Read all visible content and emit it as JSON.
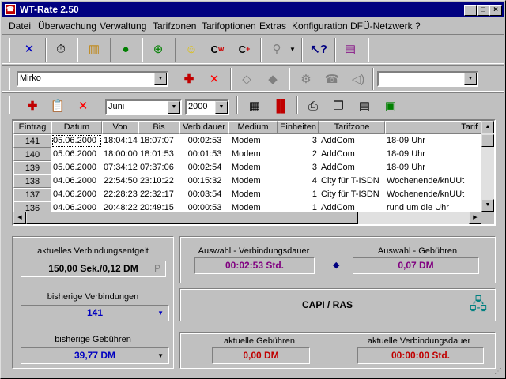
{
  "window": {
    "title": "WT-Rate 2.50"
  },
  "menu": [
    "Datei",
    "Überwachung",
    "Verwaltung",
    "Tarifzonen",
    "Tarifoptionen",
    "Extras",
    "Konfiguration",
    "DFÜ-Netzwerk",
    "?"
  ],
  "toolbar2": {
    "user_value": "Mirko",
    "second_value": ""
  },
  "toolbar3": {
    "month_value": "Juni",
    "year_value": "2000"
  },
  "table": {
    "headers": [
      "Eintrag",
      "Datum",
      "Von",
      "Bis",
      "Verb.dauer",
      "Medium",
      "Einheiten",
      "Tarifzone",
      "Tarif"
    ],
    "rows": [
      [
        "141",
        "05.06.2000",
        "18:04:14",
        "18:07:07",
        "00:02:53",
        "Modem",
        "3",
        "AddCom",
        "18-09 Uhr"
      ],
      [
        "140",
        "05.06.2000",
        "18:00:00",
        "18:01:53",
        "00:01:53",
        "Modem",
        "2",
        "AddCom",
        "18-09 Uhr"
      ],
      [
        "139",
        "05.06.2000",
        "07:34:12",
        "07:37:06",
        "00:02:54",
        "Modem",
        "3",
        "AddCom",
        "18-09 Uhr"
      ],
      [
        "138",
        "04.06.2000",
        "22:54:50",
        "23:10:22",
        "00:15:32",
        "Modem",
        "4",
        "City für T-ISDN",
        "Wochenende/knUUt"
      ],
      [
        "137",
        "04.06.2000",
        "22:28:23",
        "22:32:17",
        "00:03:54",
        "Modem",
        "1",
        "City für T-ISDN",
        "Wochenende/knUUt"
      ],
      [
        "136",
        "04.06.2000",
        "20:48:22",
        "20:49:15",
        "00:00:53",
        "Modem",
        "1",
        "AddCom",
        "rund um die Uhr"
      ]
    ]
  },
  "left": {
    "fee_label": "aktuelles Verbindungsentgelt",
    "fee_value": "150,00 Sek./0,12 DM",
    "fee_badge": "P",
    "conn_label": "bisherige Verbindungen",
    "conn_value": "141",
    "fees_label": "bisherige Gebühren",
    "fees_value": "39,77 DM"
  },
  "right": {
    "sel_duration_label": "Auswahl - Verbindungsdauer",
    "sel_duration_value": "00:02:53 Std.",
    "sel_fees_label": "Auswahl - Gebühren",
    "sel_fees_value": "0,07 DM",
    "capi_label": "CAPI / RAS",
    "cur_fees_label": "aktuelle Gebühren",
    "cur_fees_value": "0,00 DM",
    "cur_duration_label": "aktuelle Verbindungsdauer",
    "cur_duration_value": "00:00:00 Std."
  }
}
